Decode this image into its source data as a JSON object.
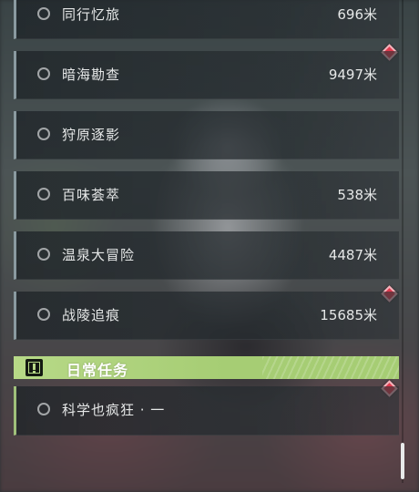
{
  "tasks": [
    {
      "name": "同行忆旅",
      "distance": "696米"
    },
    {
      "name": "暗海勘查",
      "distance": "9497米"
    },
    {
      "name": "狩原逐影",
      "distance": ""
    },
    {
      "name": "百味荟萃",
      "distance": "538米"
    },
    {
      "name": "温泉大冒险",
      "distance": "4487米"
    },
    {
      "name": "战陵追痕",
      "distance": "15685米"
    }
  ],
  "daily_section": {
    "title": "日常任务",
    "icon": "exclamation-box-icon",
    "tasks": [
      {
        "name": "科学也疯狂 · 一",
        "distance": ""
      }
    ]
  },
  "colors": {
    "accent_green": "#a6cd74",
    "marker_red": "#e23a4e",
    "row_border": "#8a9aa0"
  }
}
